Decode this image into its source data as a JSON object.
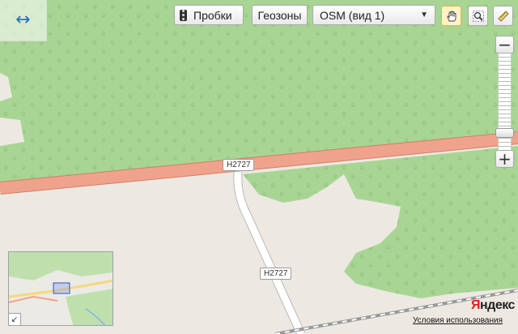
{
  "toolbar": {
    "traffic_label": "Пробки",
    "geozones_label": "Геозоны",
    "layer_selected": "OSM (вид 1)"
  },
  "icons": {
    "expand": "expand-arrows-icon",
    "traffic": "traffic-light-icon",
    "hand": "hand-pan-icon",
    "magnifier": "magnifier-zoom-icon",
    "ruler": "ruler-icon",
    "dropdown": "chevron-down-icon"
  },
  "map": {
    "road_labels": [
      "H2727",
      "H2727"
    ],
    "colors": {
      "forest": "#a8d594",
      "land": "#ede9e2",
      "main_road": "#f0a38c",
      "main_road_edge": "#d27d68",
      "side_road": "#ffffff"
    }
  },
  "zoom": {
    "minus": "−",
    "plus": "+"
  },
  "brand": {
    "logo_first": "Я",
    "logo_rest": "ндекс",
    "terms": "Условия использования"
  },
  "minimap": {
    "toggle": "↙"
  }
}
